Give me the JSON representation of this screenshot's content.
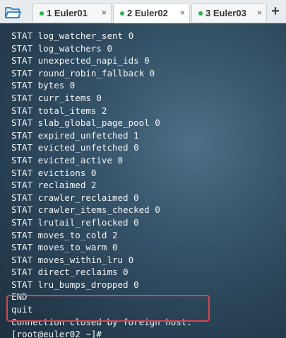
{
  "tabs": [
    {
      "label": "1 Euler01",
      "close": "×"
    },
    {
      "label": "2 Euler02",
      "close": "×"
    },
    {
      "label": "3 Euler03",
      "close": "×"
    }
  ],
  "add_tab": "+",
  "terminal": {
    "lines": [
      "STAT log_watcher_sent 0",
      "STAT log_watchers 0",
      "STAT unexpected_napi_ids 0",
      "STAT round_robin_fallback 0",
      "STAT bytes 0",
      "STAT curr_items 0",
      "STAT total_items 2",
      "STAT slab_global_page_pool 0",
      "STAT expired_unfetched 1",
      "STAT evicted_unfetched 0",
      "STAT evicted_active 0",
      "STAT evictions 0",
      "STAT reclaimed 2",
      "STAT crawler_reclaimed 0",
      "STAT crawler_items_checked 0",
      "STAT lrutail_reflocked 0",
      "STAT moves_to_cold 2",
      "STAT moves_to_warm 0",
      "STAT moves_within_lru 0",
      "STAT direct_reclaims 0",
      "STAT lru_bumps_dropped 0",
      "END",
      "quit",
      "Connection closed by foreign host.",
      "[root@euler02 ~]#"
    ]
  },
  "colors": {
    "status_dot": "#2bb24c",
    "highlight_border": "#d9454a",
    "folder": "#1e7fd0"
  }
}
